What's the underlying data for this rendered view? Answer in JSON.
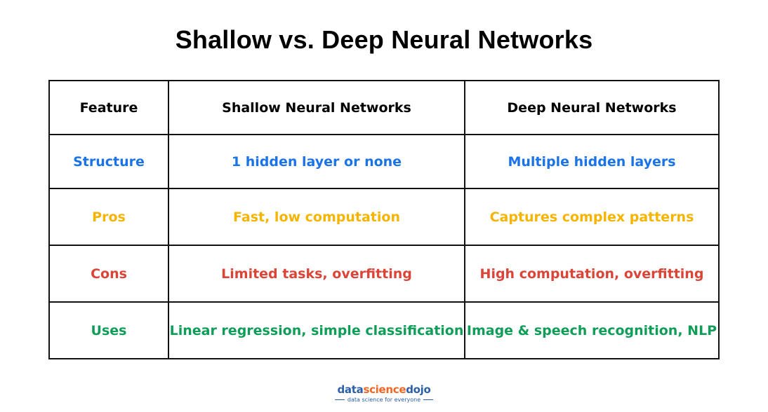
{
  "title": "Shallow vs. Deep Neural Networks",
  "colors": {
    "structure": "#1a73e8",
    "pros": "#f4b400",
    "cons": "#db4437",
    "uses": "#0f9d58",
    "header": "#000000"
  },
  "table": {
    "headers": [
      "Feature",
      "Shallow Neural Networks",
      "Deep Neural Networks"
    ],
    "rows": [
      {
        "feature": "Structure",
        "shallow": "1 hidden layer or none",
        "deep": "Multiple hidden layers",
        "color": "#1a73e8"
      },
      {
        "feature": "Pros",
        "shallow": "Fast, low computation",
        "deep": "Captures complex patterns",
        "color": "#f4b400"
      },
      {
        "feature": "Cons",
        "shallow": "Limited tasks, overfitting",
        "deep": "High computation, overfitting",
        "color": "#db4437"
      },
      {
        "feature": "Uses",
        "shallow": "Linear regression, simple classification",
        "deep": "Image & speech recognition, NLP",
        "color": "#0f9d58"
      }
    ]
  },
  "logo": {
    "part1": "data",
    "part2": "science",
    "part3": "dojo",
    "tagline": "data science for everyone",
    "color_primary": "#2b5fa8",
    "color_accent": "#f26522"
  }
}
